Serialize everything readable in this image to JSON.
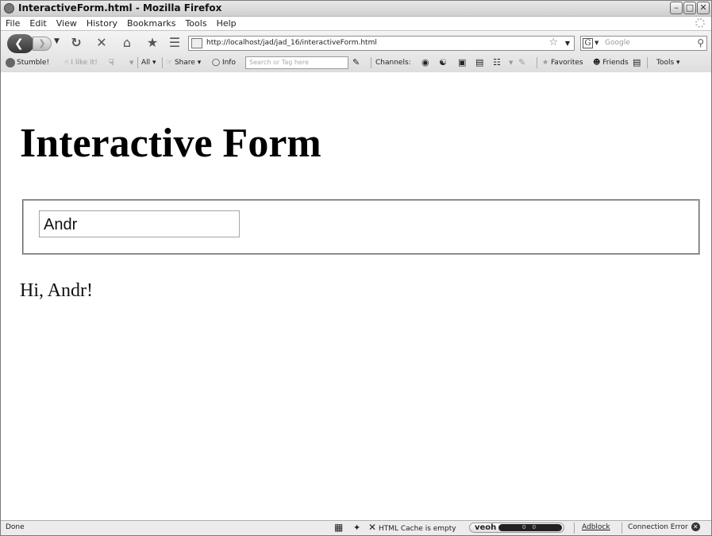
{
  "window": {
    "title": "InteractiveForm.html - Mozilla Firefox",
    "controls": [
      "minimize",
      "maximize",
      "close"
    ]
  },
  "menu": {
    "items": [
      "File",
      "Edit",
      "View",
      "History",
      "Bookmarks",
      "Tools",
      "Help"
    ]
  },
  "navigation": {
    "url": "http://localhost/jad/jad_16/interactiveForm.html",
    "search_engine_letter": "G",
    "search_placeholder": "Google"
  },
  "toolbar": {
    "stumble": "Stumble!",
    "ilike": "I like it!",
    "all": "All",
    "share": "Share",
    "info": "Info",
    "tag_search_placeholder": "Search or Tag here",
    "channels": "Channels:",
    "favorites": "Favorites",
    "friends": "Friends",
    "tools": "Tools"
  },
  "page": {
    "heading": "Interactive Form",
    "name_input_value": "Andr",
    "greeting": "Hi, Andr!"
  },
  "status": {
    "left": "Done",
    "cache": "HTML Cache is empty",
    "veoh_label": "veoh",
    "veoh_counts": "0 0",
    "adblock": "Adblock",
    "connection": "Connection Error"
  }
}
